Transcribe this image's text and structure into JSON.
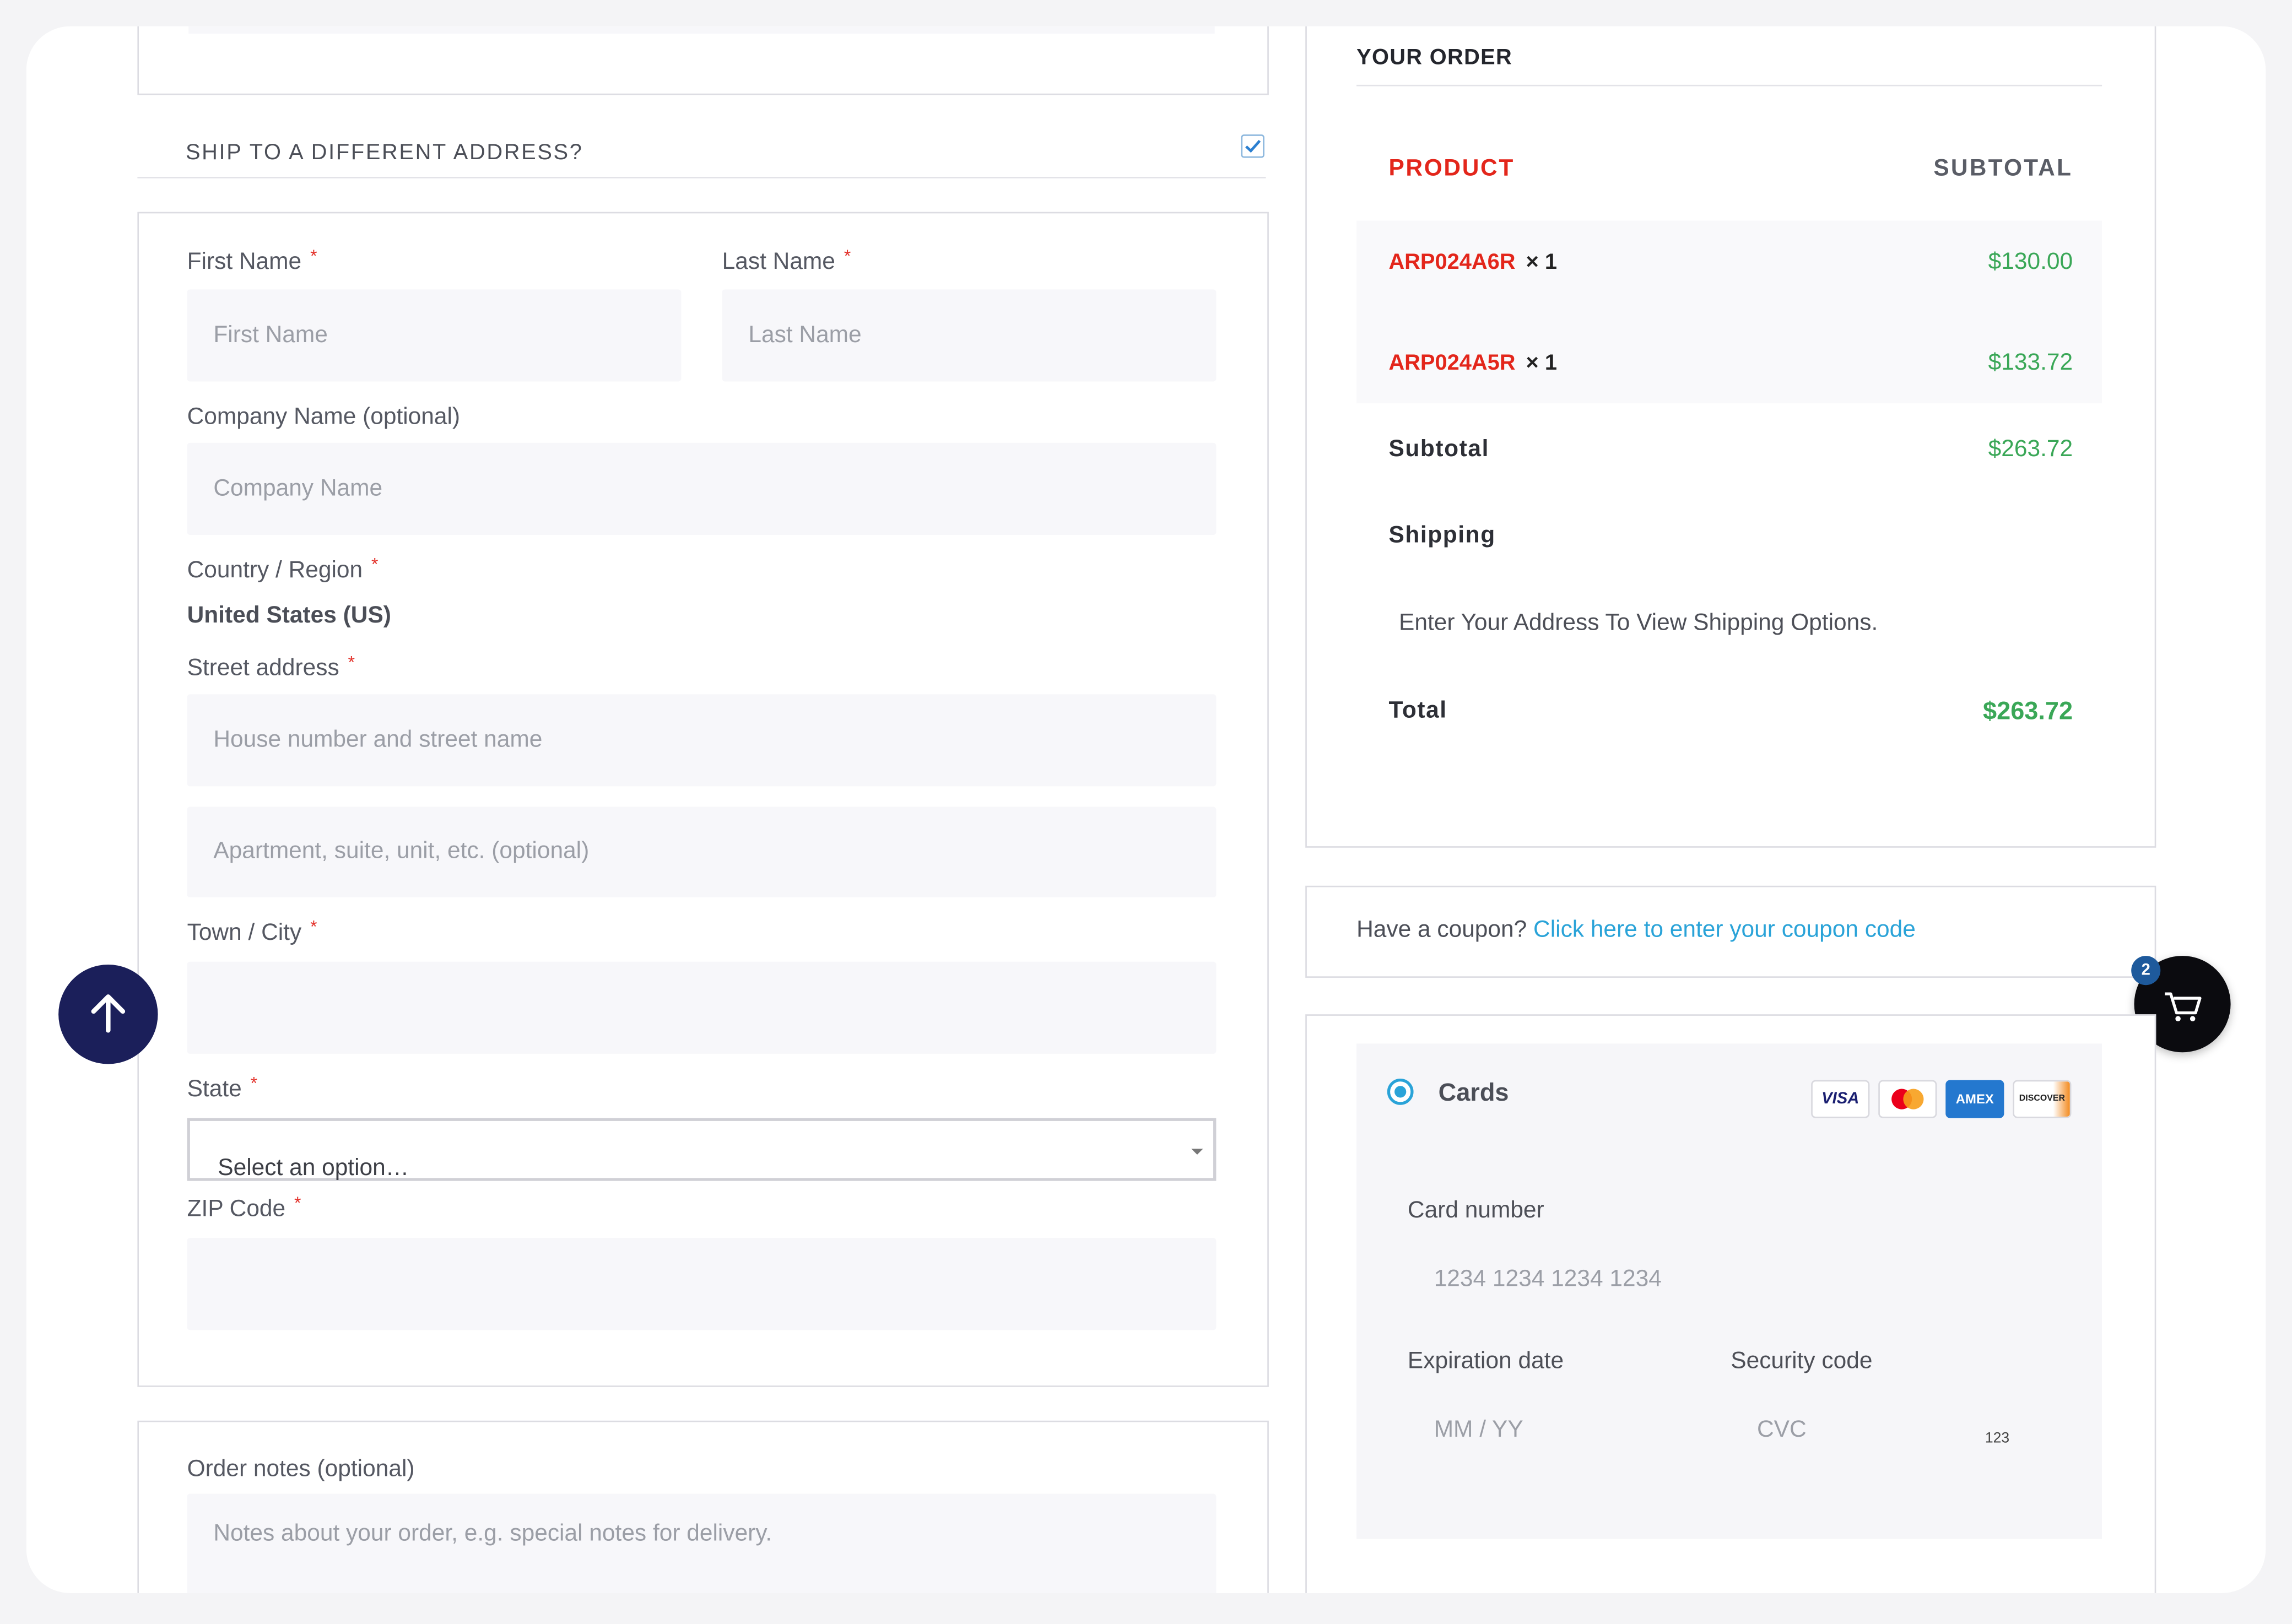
{
  "shipping": {
    "heading": "SHIP TO A DIFFERENT ADDRESS?",
    "checked": true,
    "first_name": {
      "label": "First Name",
      "placeholder": "First Name",
      "required": "*"
    },
    "last_name": {
      "label": "Last Name",
      "placeholder": "Last Name",
      "required": "*"
    },
    "company": {
      "label": "Company Name (optional)",
      "placeholder": "Company Name"
    },
    "country": {
      "label": "Country / Region",
      "value": "United States (US)",
      "required": "*"
    },
    "street": {
      "label": "Street address",
      "placeholder1": "House number and street name",
      "placeholder2": "Apartment, suite, unit, etc. (optional)",
      "required": "*"
    },
    "city": {
      "label": "Town / City",
      "required": "*"
    },
    "state": {
      "label": "State",
      "value": "Select an option…",
      "required": "*"
    },
    "zip": {
      "label": "ZIP Code",
      "required": "*"
    }
  },
  "notes": {
    "label": "Order notes (optional)",
    "placeholder": "Notes about your order, e.g. special notes for delivery."
  },
  "order": {
    "heading": "YOUR ORDER",
    "col_product": "PRODUCT",
    "col_subtotal": "SUBTOTAL",
    "items": [
      {
        "name": "ARP024A6R",
        "qty": "× 1",
        "price": "$130.00"
      },
      {
        "name": "ARP024A5R",
        "qty": "× 1",
        "price": "$133.72"
      }
    ],
    "subtotal_label": "Subtotal",
    "subtotal_value": "$263.72",
    "shipping_label": "Shipping",
    "shipping_note": "Enter Your Address To View Shipping Options.",
    "total_label": "Total",
    "total_value": "$263.72"
  },
  "coupon": {
    "prompt": "Have a coupon?",
    "link": "Click here to enter your coupon code"
  },
  "payment": {
    "method": "Cards",
    "brands": [
      "VISA",
      "mastercard",
      "AMEX",
      "DISCOVER"
    ],
    "card_number_label": "Card number",
    "card_number_placeholder": "1234 1234 1234 1234",
    "expiry_label": "Expiration date",
    "expiry_placeholder": "MM / YY",
    "cvc_label": "Security code",
    "cvc_placeholder": "CVC",
    "cvc_hint": "123"
  },
  "cart": {
    "count": "2"
  },
  "colors": {
    "accent_red": "#e3261b",
    "price_green": "#3aa757",
    "link_blue": "#2aa3d8",
    "scroll_top_bg": "#1b1f5a",
    "badge_blue": "#1e5a9c"
  }
}
